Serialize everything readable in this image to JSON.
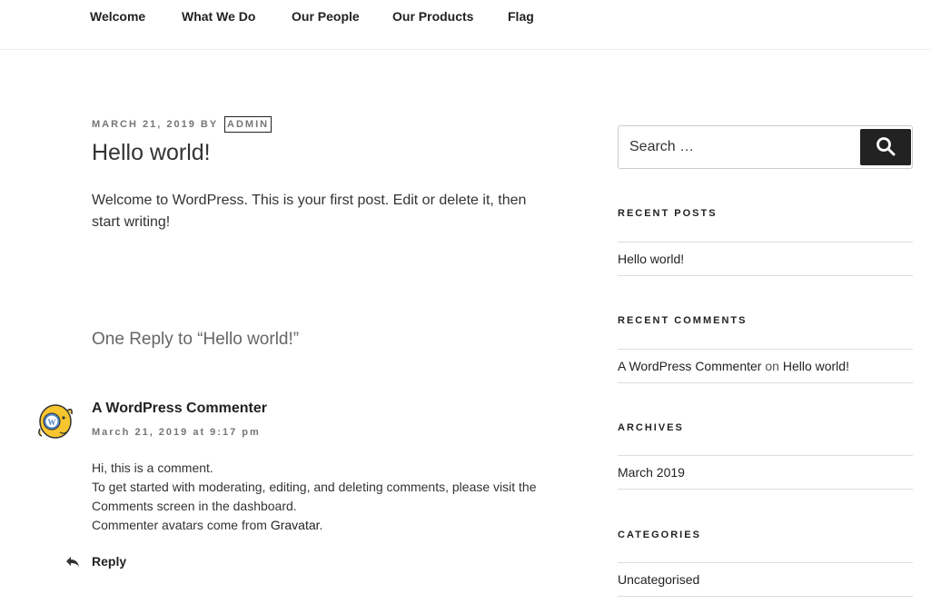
{
  "nav": {
    "items": [
      "Welcome",
      "What We Do",
      "Our People",
      "Our Products",
      "Flag"
    ]
  },
  "post": {
    "date": "March 21, 2019",
    "by": "by",
    "author": "admin",
    "title": "Hello world!",
    "body": "Welcome to WordPress. This is your first post. Edit or delete it, then start writing!"
  },
  "comments": {
    "title": "One Reply to “Hello world!”",
    "items": [
      {
        "author": "A WordPress Commenter",
        "date": "March 21, 2019 at 9:17 pm",
        "line1": "Hi, this is a comment.",
        "line2": "To get started with moderating, editing, and deleting comments, please visit the Comments screen in the dashboard.",
        "line3_prefix": "Commenter avatars come from ",
        "line3_link": "Gravatar",
        "line3_suffix": ".",
        "reply": "Reply",
        "reply_icon": "reply-arrow-icon",
        "avatar_icon": "wapuu-avatar-icon"
      }
    ]
  },
  "sidebar": {
    "search": {
      "placeholder": "Search …",
      "button_icon": "search-icon",
      "button_label": "Search"
    },
    "recent_posts": {
      "title": "Recent Posts",
      "items": [
        "Hello world!"
      ]
    },
    "recent_comments": {
      "title": "Recent Comments",
      "items": [
        {
          "author": "A WordPress Commenter",
          "on": "on",
          "post": "Hello world!"
        }
      ]
    },
    "archives": {
      "title": "Archives",
      "items": [
        "March 2019"
      ]
    },
    "categories": {
      "title": "Categories",
      "items": [
        "Uncategorised"
      ]
    }
  },
  "colors": {
    "text": "#222222",
    "meta": "#767676",
    "border": "#dddddd",
    "button": "#222222"
  }
}
